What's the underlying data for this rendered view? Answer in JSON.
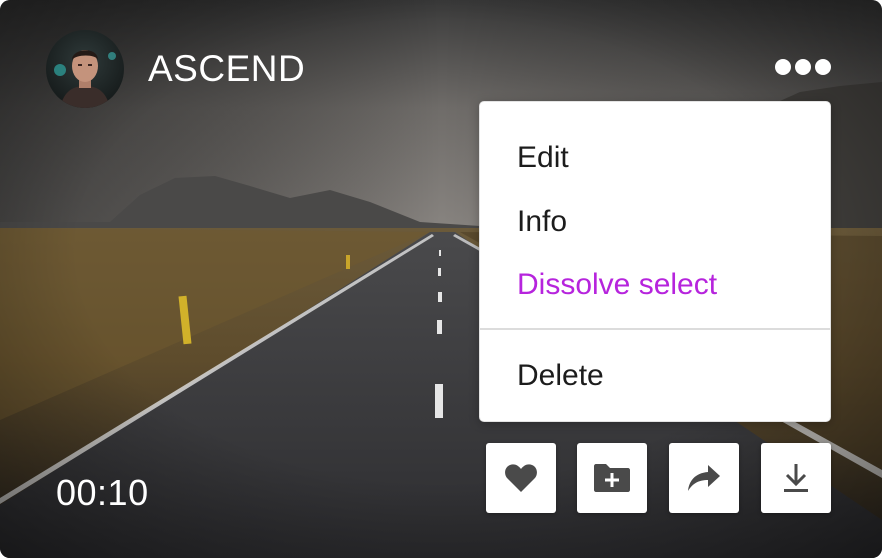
{
  "post": {
    "channel_name": "ASCEND",
    "timestamp": "00:10"
  },
  "menu": {
    "items": [
      {
        "label": "Edit",
        "color": "#1c1c1c"
      },
      {
        "label": "Info",
        "color": "#1c1c1c"
      },
      {
        "label": "Dissolve select",
        "color": "#b624dd"
      },
      {
        "label": "Delete",
        "color": "#1c1c1c"
      }
    ]
  },
  "actions": {
    "icons": [
      "heart-icon",
      "folder-plus-icon",
      "share-arrow-icon",
      "download-icon"
    ]
  },
  "colors": {
    "accent": "#b624dd",
    "menu_text": "#1c1c1c",
    "icon": "#4a4a4a"
  }
}
